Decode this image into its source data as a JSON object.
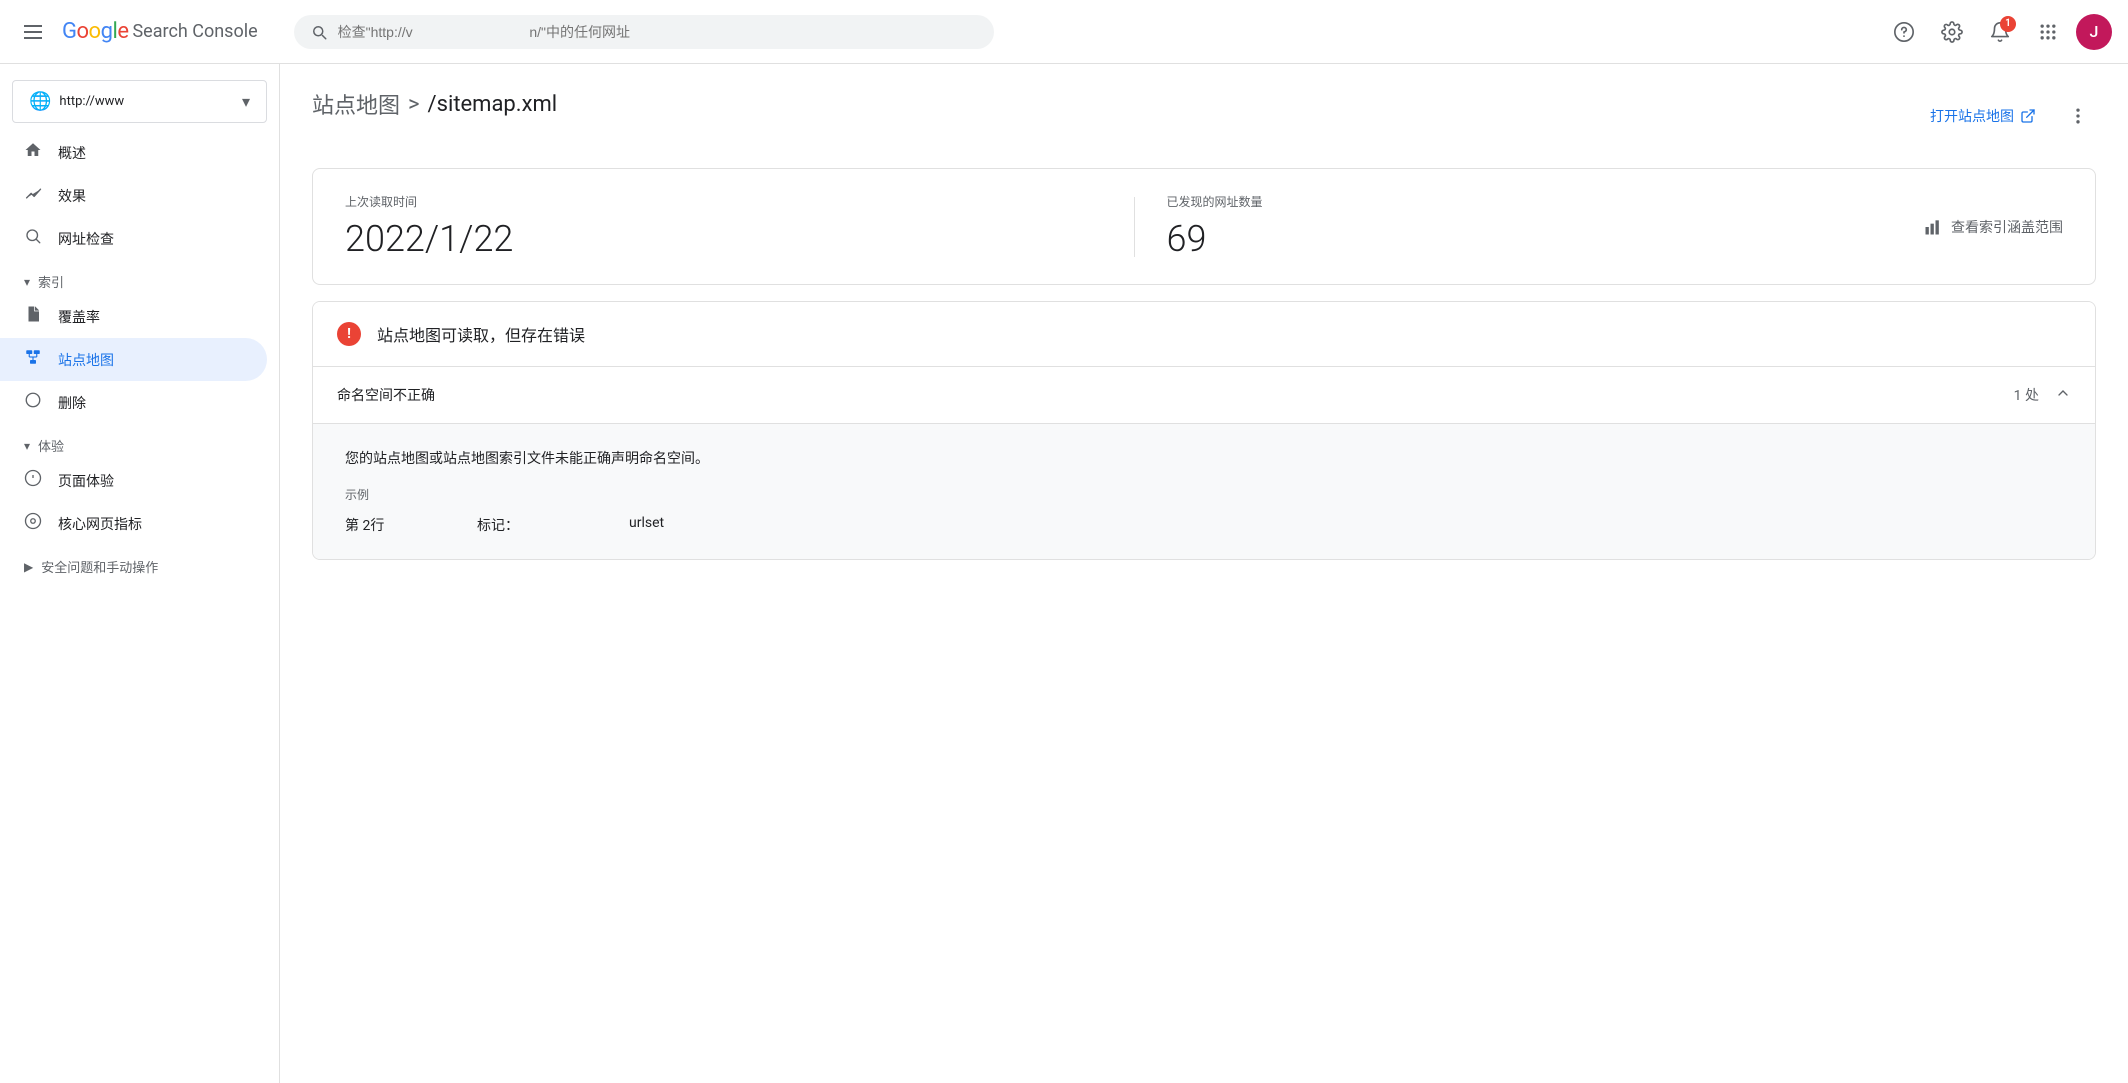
{
  "header": {
    "app_title": "Google Search Console",
    "logo_text": "Google",
    "console_text": "Search Console",
    "search_placeholder": "检查\"http://v                              n/\"中的任何网址",
    "notification_count": "1",
    "avatar_letter": "J"
  },
  "sidebar": {
    "site_url": "http://www",
    "nav_items": [
      {
        "id": "overview",
        "label": "概述",
        "icon": "🏠"
      },
      {
        "id": "performance",
        "label": "效果",
        "icon": "📈"
      },
      {
        "id": "url-inspection",
        "label": "网址检查",
        "icon": "🔍"
      }
    ],
    "index_section": "索引",
    "index_items": [
      {
        "id": "coverage",
        "label": "覆盖率",
        "icon": "📄"
      },
      {
        "id": "sitemaps",
        "label": "站点地图",
        "icon": "🗺",
        "active": true
      },
      {
        "id": "removals",
        "label": "删除",
        "icon": "🚫"
      }
    ],
    "experience_section": "体验",
    "experience_items": [
      {
        "id": "page-experience",
        "label": "页面体验",
        "icon": "⊕"
      },
      {
        "id": "core-web-vitals",
        "label": "核心网页指标",
        "icon": "⊙"
      }
    ],
    "security_section": "安全问题和手动操作"
  },
  "breadcrumb": {
    "parent": "站点地图",
    "separator": ">",
    "current": "/sitemap.xml"
  },
  "page_actions": {
    "open_label": "打开站点地图",
    "more_label": "更多"
  },
  "stats": {
    "last_read_label": "上次读取时间",
    "last_read_value": "2022/1/22",
    "discovered_label": "已发现的网址数量",
    "discovered_value": "69",
    "coverage_action": "查看索引涵盖范围"
  },
  "error_card": {
    "status_message": "站点地图可读取，但存在错误",
    "error_row_title": "命名空间不正确",
    "error_row_count": "1 处",
    "error_detail_text": "您的站点地图或站点地图索引文件未能正确声明命名空间。",
    "example_label": "示例",
    "example_row": {
      "line": "第 2行",
      "tag_label": "标记：",
      "tag_value": "urlset"
    }
  }
}
